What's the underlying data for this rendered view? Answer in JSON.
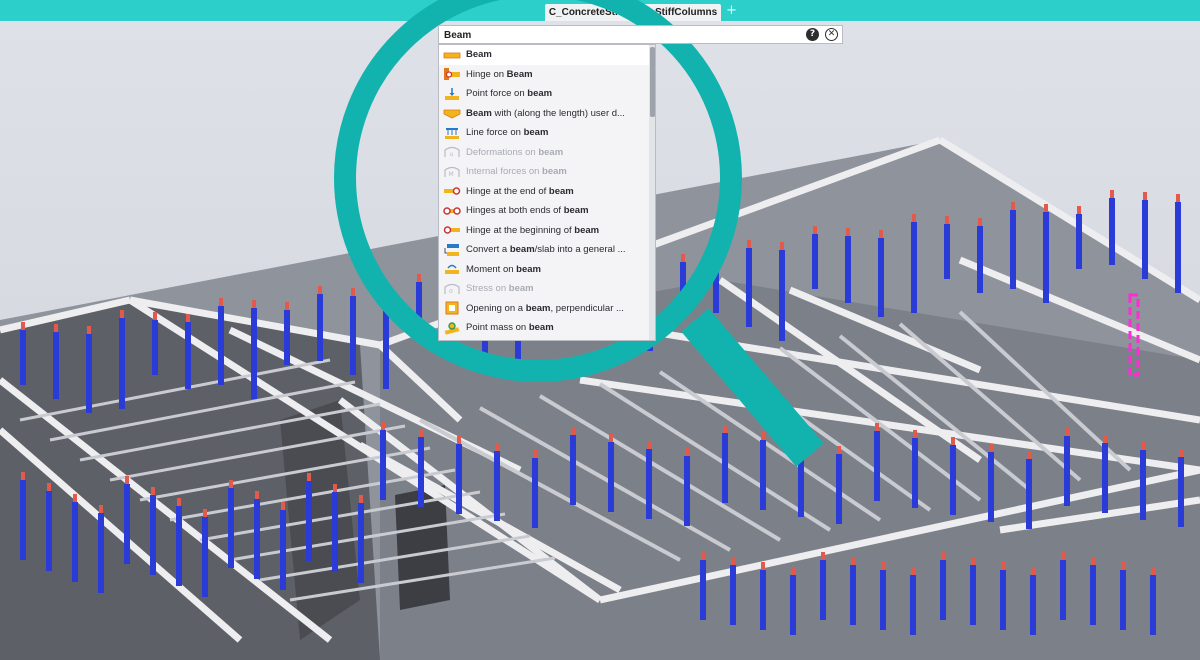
{
  "tabs": {
    "active_label": "C_ConcreteStructure_StiffColumns",
    "new_tab_label": "+"
  },
  "search": {
    "value": "Beam",
    "placeholder": ""
  },
  "help_glyph": "?",
  "close_glyph": "✕",
  "results": [
    {
      "label": "Beam",
      "icon": "beam-icon",
      "enabled": true,
      "selected": true
    },
    {
      "label": "Hinge on Beam",
      "icon": "beam-hinge-icon",
      "enabled": true
    },
    {
      "label": "Point force on beam",
      "icon": "point-force-icon",
      "enabled": true
    },
    {
      "label": "Beam with (along the length) user d...",
      "icon": "variable-beam-icon",
      "enabled": true
    },
    {
      "label": "Line force on beam",
      "icon": "line-force-icon",
      "enabled": true
    },
    {
      "label": "Deformations on beam",
      "icon": "deformation-icon",
      "enabled": false
    },
    {
      "label": "Internal forces on beam",
      "icon": "internal-forces-icon",
      "enabled": false
    },
    {
      "label": "Hinge at the end of beam",
      "icon": "hinge-end-icon",
      "enabled": true
    },
    {
      "label": "Hinges at both ends of beam",
      "icon": "hinge-both-icon",
      "enabled": true
    },
    {
      "label": "Hinge at the beginning of beam",
      "icon": "hinge-begin-icon",
      "enabled": true
    },
    {
      "label": "Convert a beam/slab into a general ...",
      "icon": "convert-icon",
      "enabled": true
    },
    {
      "label": "Moment on beam",
      "icon": "moment-icon",
      "enabled": true
    },
    {
      "label": "Stress on beam",
      "icon": "stress-icon",
      "enabled": false
    },
    {
      "label": "Opening on a beam, perpendicular ...",
      "icon": "opening-icon",
      "enabled": true
    },
    {
      "label": "Point mass on beam",
      "icon": "point-mass-icon",
      "enabled": true
    }
  ],
  "colors": {
    "accent": "#2ccfc9",
    "column": "#2a3bd8",
    "beam": "#eeeef0",
    "highlight": "#ff2bd6"
  }
}
